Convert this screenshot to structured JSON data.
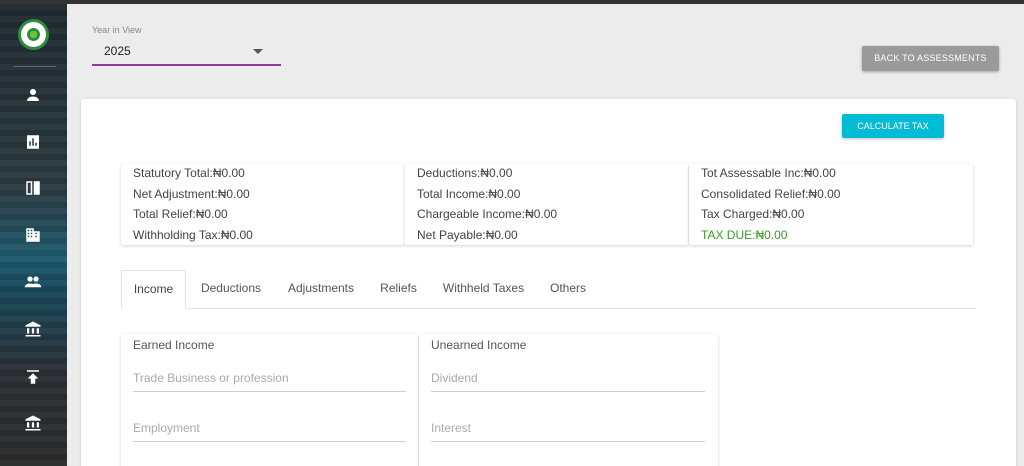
{
  "sidebar": {
    "icons": [
      "user-icon",
      "chart-icon",
      "compare-icon",
      "building-icon",
      "group-icon",
      "bank-icon",
      "upload-icon",
      "bank-icon"
    ]
  },
  "year": {
    "label": "Year in View",
    "value": "2025"
  },
  "buttons": {
    "back": "BACK TO ASSESSMENTS",
    "calculate": "CALCULATE TAX"
  },
  "summary": {
    "col1": [
      "Statutory Total:₦0.00",
      "Net Adjustment:₦0.00",
      "Total Relief:₦0.00",
      "Withholding Tax:₦0.00"
    ],
    "col2": [
      "Deductions:₦0.00",
      "Total Income:₦0.00",
      "Chargeable Income:₦0.00",
      "Net Payable:₦0.00"
    ],
    "col3": [
      "Tot Assessable Inc:₦0.00",
      "Consolidated Relief:₦0.00",
      "Tax Charged:₦0.00",
      "TAX DUE:₦0.00"
    ]
  },
  "tabs": [
    "Income",
    "Deductions",
    "Adjustments",
    "Reliefs",
    "Withheld Taxes",
    "Others"
  ],
  "active_tab": "Income",
  "earned": {
    "title": "Earned Income",
    "fields": [
      "Trade Business or profession",
      "Employment"
    ]
  },
  "unearned": {
    "title": "Unearned Income",
    "fields": [
      "Dividend",
      "Interest"
    ]
  },
  "colors": {
    "accent_cyan": "#00bcd4",
    "underline_purple": "#8e3b9e",
    "tax_due_green": "#3c9a2a",
    "back_button_gray": "#9a9a9a"
  }
}
